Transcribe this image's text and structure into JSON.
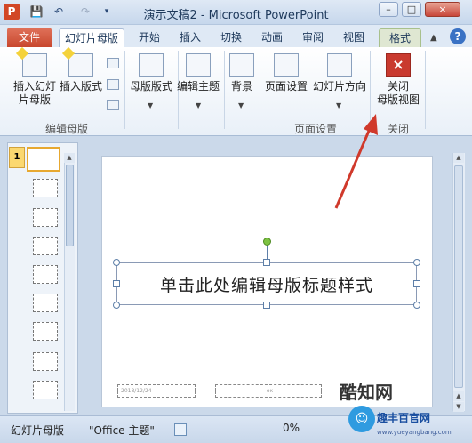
{
  "window": {
    "title": "演示文稿2 - Microsoft PowerPoint",
    "app_icon_letter": "P",
    "minimize": "–",
    "maximize": "□",
    "close": "×"
  },
  "qat": {
    "save": "💾",
    "undo": "↶",
    "redo": "↷"
  },
  "tabs": {
    "file": "文件",
    "slide_master": "幻灯片母版",
    "home": "开始",
    "insert": "插入",
    "transitions": "切换",
    "animations": "动画",
    "review": "审阅",
    "view": "视图",
    "format": "格式",
    "help": "?"
  },
  "ribbon": {
    "insert_master": [
      "插入幻灯",
      "片母版"
    ],
    "insert_layout": "插入版式",
    "master_layout": "母版版式",
    "edit_theme": "编辑主题",
    "background": "背景",
    "page_setup": "页面设置",
    "slide_orientation": "幻灯片方向",
    "close_master": [
      "关闭",
      "母版视图"
    ],
    "group_edit_master": "编辑母版",
    "group_page_setup": "页面设置",
    "group_close": "关闭"
  },
  "thumbnails": {
    "selected_number": "1"
  },
  "slide": {
    "title_placeholder": "单击此处编辑母版标题样式",
    "date_placeholder": "2018/12/24",
    "footer_placeholder": "ок"
  },
  "status": {
    "view": "幻灯片母版",
    "theme": "\"Office 主题\"",
    "zoom": "0%"
  },
  "watermark": {
    "text1": "酷知网",
    "text2": "趣丰百官网",
    "url": "www.yueyangbang.com"
  },
  "colors": {
    "accent_red": "#d0392b",
    "file_tab": "#c8472e",
    "selected_thumb": "#e7a830"
  }
}
